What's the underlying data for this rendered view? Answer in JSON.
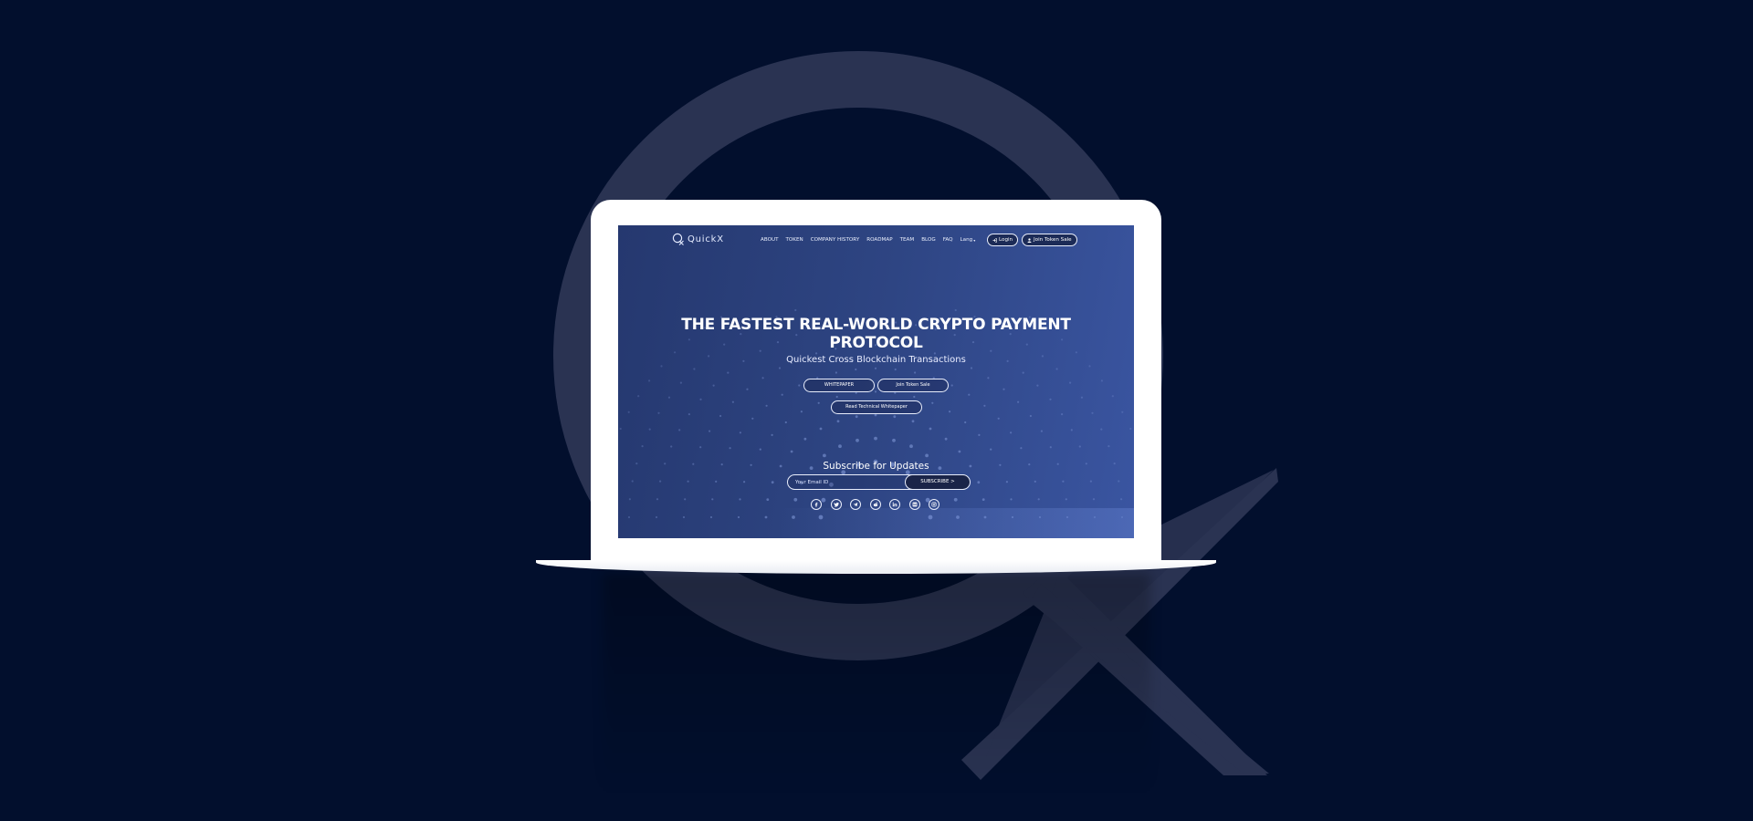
{
  "brand": {
    "name": "QuickX"
  },
  "nav": {
    "items": [
      {
        "label": "ABOUT"
      },
      {
        "label": "TOKEN"
      },
      {
        "label": "COMPANY HISTORY"
      },
      {
        "label": "ROADMAP"
      },
      {
        "label": "TEAM"
      },
      {
        "label": "BLOG"
      },
      {
        "label": "FAQ"
      }
    ],
    "language": "Lang",
    "login_label": "Login",
    "join_label": "Join Token Sale"
  },
  "hero": {
    "title": "THE FASTEST REAL-WORLD CRYPTO PAYMENT PROTOCOL",
    "subtitle": "Quickest Cross Blockchain Transactions",
    "whitepaper_label": "WHITEPAPER",
    "join_label": "Join Token Sale",
    "tech_whitepaper_label": "Read Technical Whitepaper"
  },
  "subscribe": {
    "title": "Subscribe for Updates",
    "email_placeholder": "Your Email ID",
    "button_label": "SUBSCRIBE >"
  },
  "socials": [
    {
      "icon": "facebook-icon"
    },
    {
      "icon": "twitter-icon"
    },
    {
      "icon": "telegram-icon"
    },
    {
      "icon": "reddit-icon"
    },
    {
      "icon": "linkedin-icon"
    },
    {
      "icon": "medium-icon"
    },
    {
      "icon": "instagram-icon"
    }
  ],
  "colors": {
    "page_background": "#020f2d",
    "background_mark": "#2a3352",
    "screen_gradient_start": "#25386f",
    "screen_gradient_end": "#3a55a1",
    "laptop": "#ffffff"
  }
}
